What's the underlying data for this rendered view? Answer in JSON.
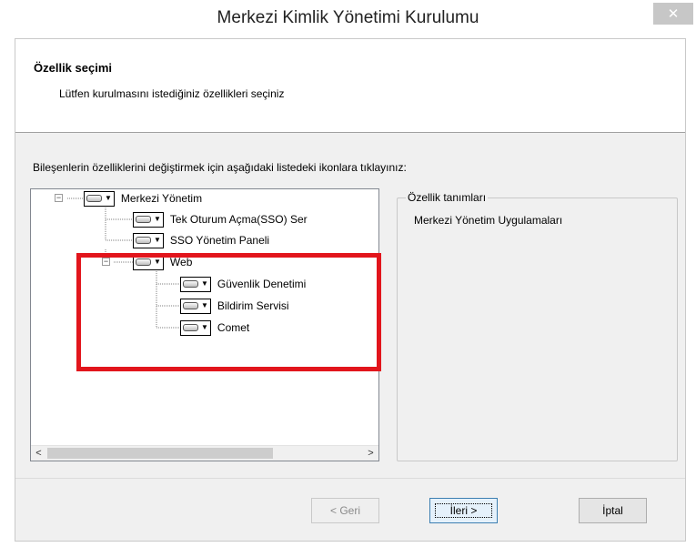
{
  "window": {
    "title": "Merkezi Kimlik Yönetimi Kurulumu",
    "close_glyph": "✕"
  },
  "header": {
    "title": "Özellik seçimi",
    "subtitle": "Lütfen kurulmasını istediğiniz özellikleri seçiniz"
  },
  "instruction": "Bileşenlerin özelliklerini değiştirmek için aşağıdaki listedeki ikonlara tıklayınız:",
  "tree": {
    "expanded_glyph": "−",
    "items": [
      {
        "label": "Merkezi Yönetim",
        "icon": "drive-icon"
      },
      {
        "label": "Tek Oturum Açma(SSO) Ser",
        "icon": "drive-icon"
      },
      {
        "label": "SSO Yönetim Paneli",
        "icon": "drive-icon"
      },
      {
        "label": "Web",
        "icon": "drive-icon"
      },
      {
        "label": "Güvenlik Denetimi",
        "icon": "drive-icon"
      },
      {
        "label": "Bildirim Servisi",
        "icon": "drive-icon"
      },
      {
        "label": "Comet",
        "icon": "drive-icon"
      }
    ],
    "scroll": {
      "left_arrow": "<",
      "right_arrow": ">"
    }
  },
  "description": {
    "legend": "Özellik tanımları",
    "text": "Merkezi Yönetim Uygulamaları"
  },
  "buttons": {
    "back": "< Geri",
    "next": "İleri >",
    "cancel": "İptal"
  },
  "colors": {
    "highlight": "#e2151c",
    "dialog_bg": "#f0f0f0",
    "primary_border": "#3c7fb1"
  }
}
